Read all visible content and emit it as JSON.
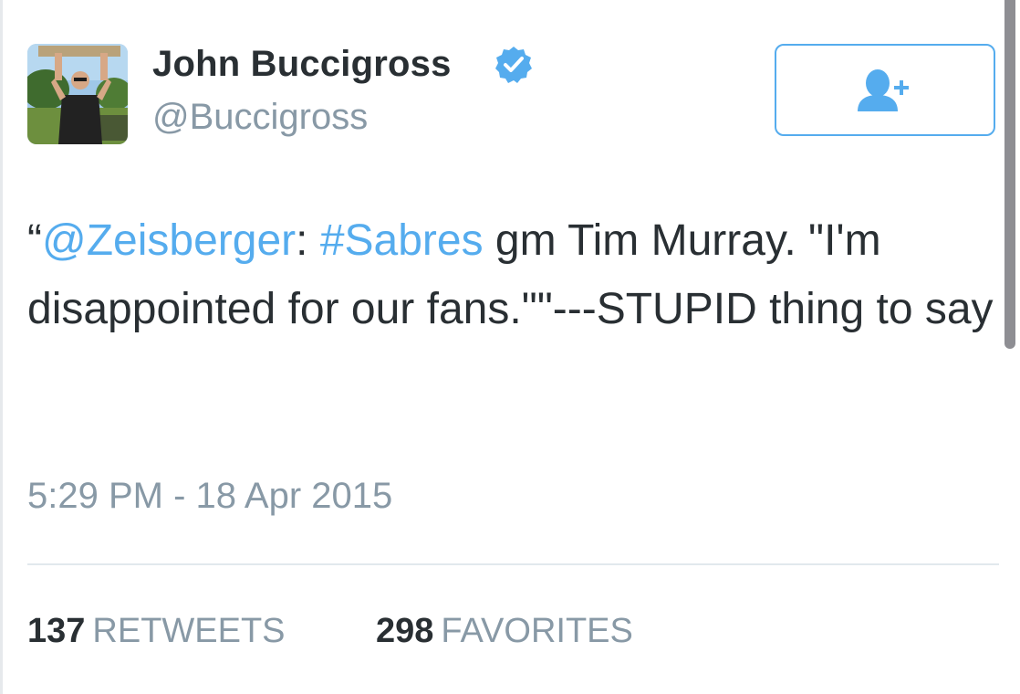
{
  "tweet": {
    "author": {
      "display_name": "John Buccigross",
      "handle": "@Buccigross",
      "verified": true
    },
    "follow_button": {
      "icon": "add-user-icon"
    },
    "text": {
      "open_quote": "“",
      "mention": "@Zeisberger",
      "colon": ": ",
      "hashtag": "#Sabres",
      "rest": " gm Tim Murray. \"I'm disappointed for our fans.\"\"---STUPID thing to say"
    },
    "timestamp": "5:29 PM - 18 Apr 2015",
    "stats": {
      "retweets": {
        "count": "137",
        "label": "RETWEETS"
      },
      "favorites": {
        "count": "298",
        "label": "FAVORITES"
      }
    }
  },
  "colors": {
    "link": "#55acee",
    "text": "#292f33",
    "muted": "#8899a6",
    "verified": "#55acee",
    "divider": "#e1e8ed"
  }
}
